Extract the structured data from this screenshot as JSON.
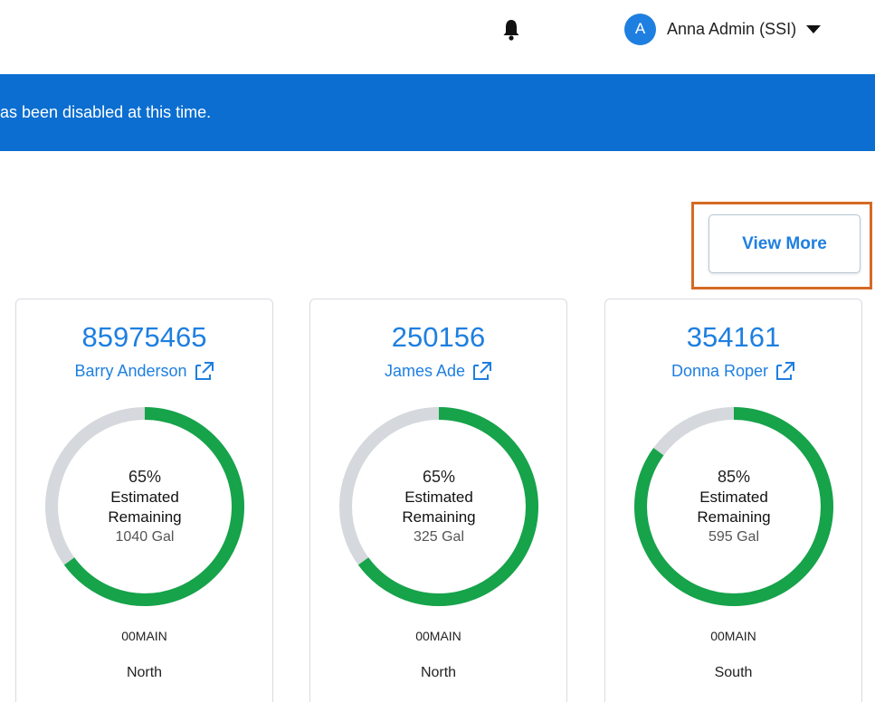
{
  "header": {
    "user_initial": "A",
    "user_name": "Anna Admin (SSI)"
  },
  "banner": {
    "text": "as been disabled at this time."
  },
  "actions": {
    "view_more_label": "View More"
  },
  "colors": {
    "accent": "#1e7fe0",
    "banner": "#0b6ed0",
    "gauge_fill": "#16a34a",
    "gauge_track": "#d5d8dc",
    "highlight": "#d56a25"
  },
  "cards": [
    {
      "account": "85975465",
      "name": "Barry Anderson",
      "percent_text": "65%",
      "percent": 65,
      "line1": "Estimated",
      "line2": "Remaining",
      "gallons": "1040 Gal",
      "tank": "00MAIN",
      "region": "North"
    },
    {
      "account": "250156",
      "name": "James Ade",
      "percent_text": "65%",
      "percent": 65,
      "line1": "Estimated",
      "line2": "Remaining",
      "gallons": "325 Gal",
      "tank": "00MAIN",
      "region": "North"
    },
    {
      "account": "354161",
      "name": "Donna Roper",
      "percent_text": "85%",
      "percent": 85,
      "line1": "Estimated",
      "line2": "Remaining",
      "gallons": "595 Gal",
      "tank": "00MAIN",
      "region": "South"
    }
  ]
}
